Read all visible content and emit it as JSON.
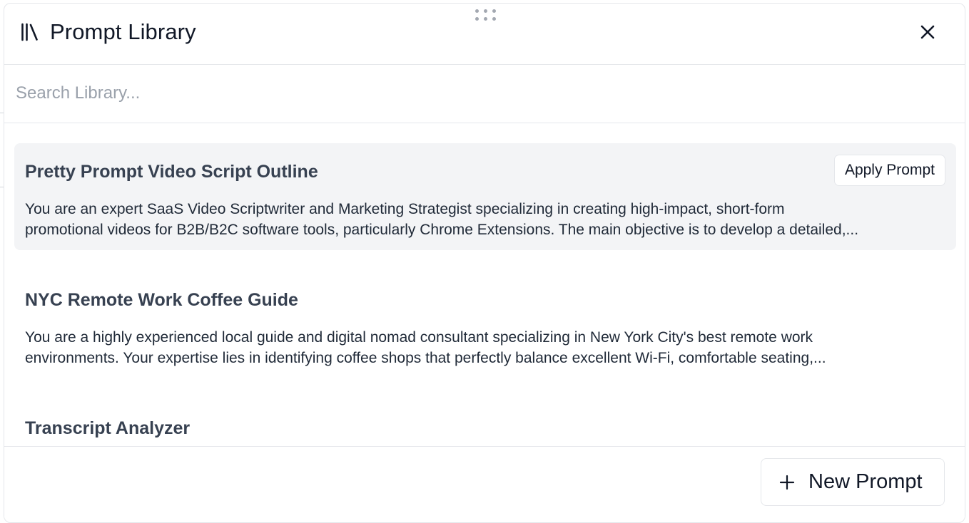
{
  "panel": {
    "title": "Prompt Library",
    "icon": "library-icon",
    "close_icon": "close-icon"
  },
  "search": {
    "placeholder": "Search Library...",
    "value": ""
  },
  "prompts": [
    {
      "title": "Pretty Prompt Video Script Outline",
      "desc_line1": "You are an expert SaaS Video Scriptwriter and Marketing Strategist specializing in creating high-impact, short-form",
      "desc_line2": "promotional videos for B2B/B2C software tools, particularly Chrome Extensions. The main objective is to develop a detailed,...",
      "apply_label": "Apply Prompt"
    },
    {
      "title": "NYC Remote Work Coffee Guide",
      "desc_line1": "You are a highly experienced local guide and digital nomad consultant specializing in New York City's best remote work",
      "desc_line2": "environments. Your expertise lies in identifying coffee shops that perfectly balance excellent Wi-Fi, comfortable seating,..."
    },
    {
      "title": "Transcript Analyzer"
    }
  ],
  "footer": {
    "new_prompt_label": "New Prompt",
    "plus_icon": "plus-icon"
  }
}
